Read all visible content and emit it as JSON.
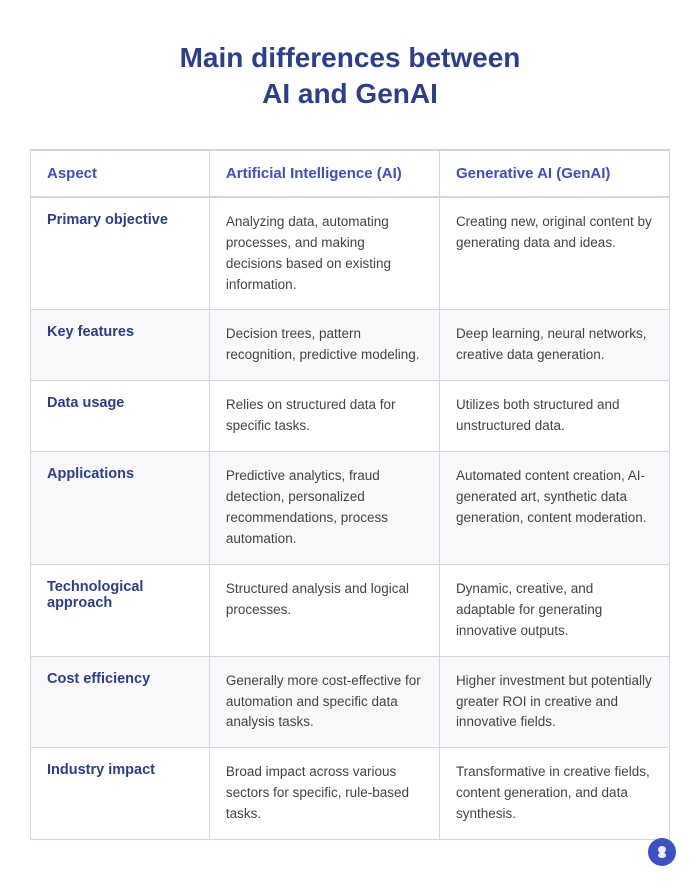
{
  "title": {
    "line1": "Main differences between",
    "line2": "AI and GenAI"
  },
  "table": {
    "headers": {
      "aspect": "Aspect",
      "ai": "Artificial Intelligence (AI)",
      "genai": "Generative AI (GenAI)"
    },
    "rows": [
      {
        "aspect": "Primary objective",
        "ai": "Analyzing data, automating processes, and making decisions based on existing information.",
        "genai": "Creating new, original content by generating data and ideas."
      },
      {
        "aspect": "Key features",
        "ai": "Decision trees, pattern recognition, predictive modeling.",
        "genai": "Deep learning, neural networks, creative data generation."
      },
      {
        "aspect": "Data usage",
        "ai": "Relies on structured data for specific tasks.",
        "genai": "Utilizes both structured and unstructured data."
      },
      {
        "aspect": "Applications",
        "ai": "Predictive analytics, fraud detection, personalized recommendations, process automation.",
        "genai": "Automated content creation, AI-generated art, synthetic data generation, content moderation."
      },
      {
        "aspect": "Technological approach",
        "ai": "Structured analysis and logical processes.",
        "genai": "Dynamic, creative, and adaptable for generating innovative outputs."
      },
      {
        "aspect": "Cost efficiency",
        "ai": "Generally more cost-effective for automation and specific data analysis tasks.",
        "genai": "Higher investment but potentially greater ROI in creative and innovative fields."
      },
      {
        "aspect": "Industry impact",
        "ai": "Broad impact across various sectors for specific, rule-based tasks.",
        "genai": "Transformative in creative fields, content generation, and data synthesis."
      }
    ]
  }
}
